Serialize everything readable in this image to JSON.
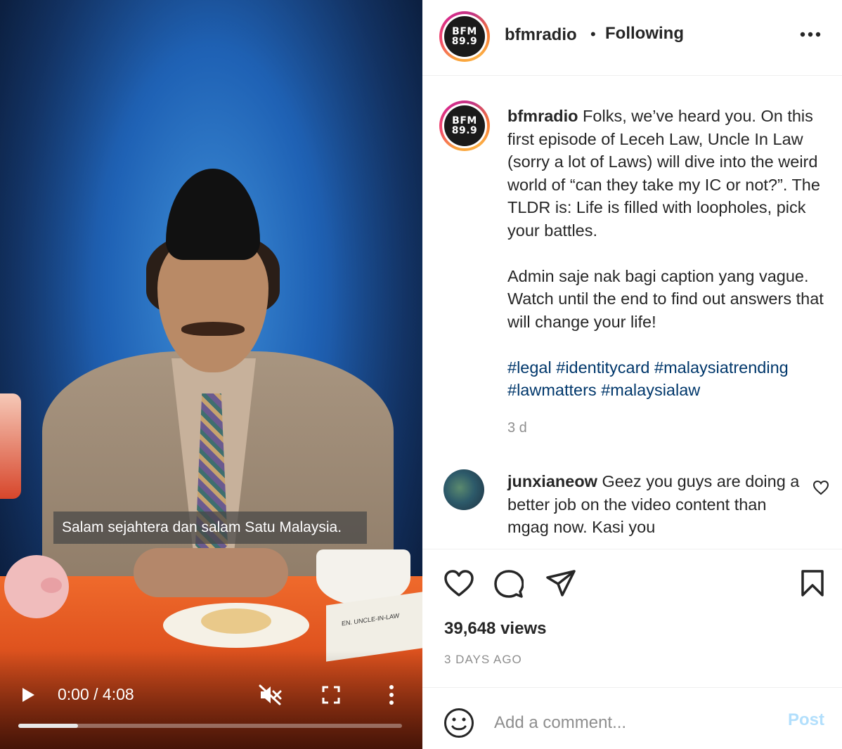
{
  "video": {
    "subtitle": "Salam sejahtera dan salam Satu Malaysia.",
    "nameplate": "EN. UNCLE-IN-LAW",
    "time": "0:00 / 4:08",
    "progress": 0.155
  },
  "header": {
    "avatar_line1": "BFM",
    "avatar_line2": "89.9",
    "username": "bfmradio",
    "separator": "•",
    "follow_status": "Following"
  },
  "caption": {
    "username": "bfmradio",
    "text": " Folks, we’ve heard you. On this first episode of Leceh Law, Uncle In Law (sorry a lot of Laws) will dive into the weird world of “can they take my IC or not?”. The TLDR is: Life is filled with loopholes, pick your battles.\n\nAdmin saje nak bagi caption yang vague. Watch until the end to find out answers that will change your life!\n\n",
    "hashtags": "#legal #identitycard #malaysiatrending #lawmatters #malaysialaw",
    "time": "3 d"
  },
  "comment": {
    "username": "junxianeow",
    "text": " Geez you guys are doing a better job on the video content than mgag now. Kasi you"
  },
  "stats": {
    "views": "39,648 views",
    "date": "3 DAYS AGO"
  },
  "composer": {
    "placeholder": "Add a comment...",
    "post_label": "Post"
  },
  "colors": {
    "link": "#00376b",
    "muted": "#8e8e8e",
    "post_disabled": "#b2dffc"
  }
}
